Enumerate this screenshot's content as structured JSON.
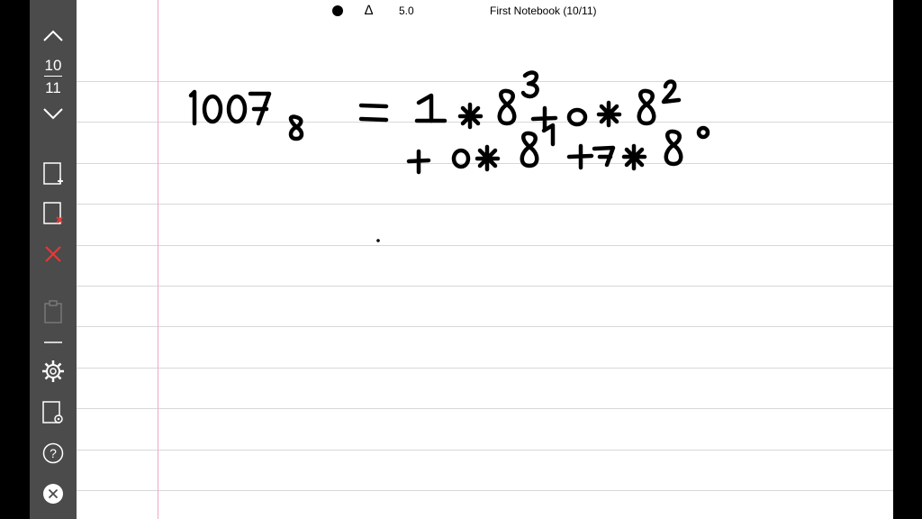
{
  "toolbar": {
    "page_current": "10",
    "page_total": "11",
    "icons": [
      "chevron-up-icon",
      "chevron-down-icon",
      "add-page-icon",
      "delete-page-icon",
      "close-red-icon",
      "clipboard-icon",
      "minus-icon",
      "settings-icon",
      "page-settings-icon",
      "help-icon",
      "exit-icon"
    ]
  },
  "topbar": {
    "pen_size": "5.0",
    "title": "First Notebook (10/11)"
  },
  "handwriting": {
    "line1_lhs": "1007",
    "line1_lhs_base": "8",
    "line1_rhs": "= 1 * 8^3 + 0 * 8^2",
    "line2": "+ 0 * 8^1 + 7 * 8^0"
  },
  "colors": {
    "toolbar_bg": "#4b4b4b",
    "paper_bg": "#ffffff",
    "rule_line": "#d8d8d8",
    "margin_line": "#f0a6c6",
    "danger": "#e53935"
  }
}
